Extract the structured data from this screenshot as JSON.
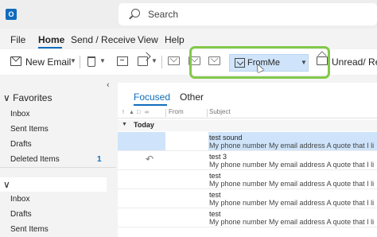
{
  "app": {
    "icon_letter": "O"
  },
  "search": {
    "placeholder": "Search"
  },
  "menu": {
    "tabs": [
      "File",
      "Home",
      "Send / Receive",
      "View",
      "Help"
    ],
    "active": "Home"
  },
  "ribbon": {
    "new_email": "New Email",
    "quick_step": "FromMe",
    "unread": "Unread/ Re"
  },
  "nav": {
    "favorites_header": "Favorites",
    "favorites": [
      {
        "label": "Inbox"
      },
      {
        "label": "Sent Items"
      },
      {
        "label": "Drafts"
      },
      {
        "label": "Deleted Items",
        "count": "1"
      }
    ],
    "account_items": [
      {
        "label": "Inbox"
      },
      {
        "label": "Drafts"
      },
      {
        "label": "Sent Items"
      }
    ]
  },
  "list": {
    "tabs": [
      "Focused",
      "Other"
    ],
    "columns": {
      "from": "From",
      "subject": "Subject"
    },
    "group": "Today",
    "messages": [
      {
        "subject": "test sound",
        "preview": "My phone number  My email address  A quote that I li"
      },
      {
        "subject": "test 3",
        "preview": "My phone number  My email address  A quote that I li"
      },
      {
        "subject": "test",
        "preview": "My phone number  My email address  A quote that I li"
      },
      {
        "subject": "test",
        "preview": "My phone number  My email address  A quote that I li"
      },
      {
        "subject": "test",
        "preview": "My phone number  My email address  A quote that I li"
      }
    ]
  },
  "colors": {
    "accent": "#0f6cbd",
    "selection": "#cfe4fa",
    "highlight": "#82c84a"
  }
}
